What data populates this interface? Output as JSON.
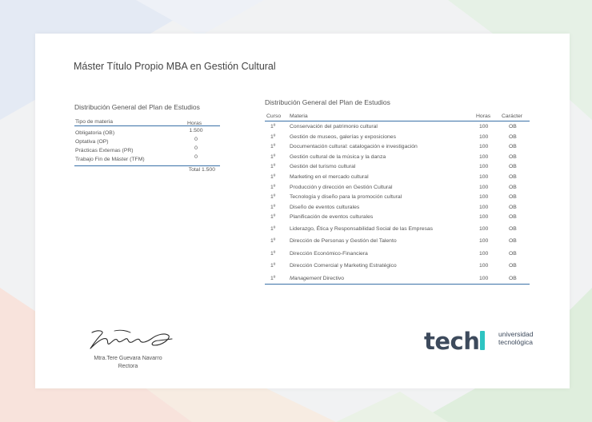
{
  "document": {
    "title": "Máster Título Propio MBA en Gestión Cultural"
  },
  "summary_table": {
    "heading": "Distribución General del Plan de Estudios",
    "col_type": "Tipo de materia",
    "col_hours": "Horas",
    "rows": [
      {
        "type": "Obligatoria (OB)",
        "hours": "1.500"
      },
      {
        "type": "Optativa (OP)",
        "hours": "0"
      },
      {
        "type": "Prácticas Externas (PR)",
        "hours": "0"
      },
      {
        "type": "Trabajo Fin de Máster (TFM)",
        "hours": "0"
      }
    ],
    "total": "Total 1.500"
  },
  "detail_table": {
    "heading": "Distribución General del Plan de Estudios",
    "col_course": "Curso",
    "col_subject": "Materia",
    "col_hours": "Horas",
    "col_type": "Carácter",
    "rows": [
      {
        "course": "1º",
        "subject": "Conservación del patrimonio cultural",
        "hours": "100",
        "type": "OB"
      },
      {
        "course": "1º",
        "subject": "Gestión de museos, galerías y exposiciones",
        "hours": "100",
        "type": "OB"
      },
      {
        "course": "1º",
        "subject": "Documentación cultural: catalogación e investigación",
        "hours": "100",
        "type": "OB"
      },
      {
        "course": "1º",
        "subject": "Gestión cultural de la música y la danza",
        "hours": "100",
        "type": "OB"
      },
      {
        "course": "1º",
        "subject": "Gestión del turismo cultural",
        "hours": "100",
        "type": "OB"
      },
      {
        "course": "1º",
        "subject": "Marketing en el mercado cultural",
        "hours": "100",
        "type": "OB"
      },
      {
        "course": "1º",
        "subject": "Producción y dirección en Gestión Cultural",
        "hours": "100",
        "type": "OB"
      },
      {
        "course": "1º",
        "subject": "Tecnología y diseño para la promoción cultural",
        "hours": "100",
        "type": "OB"
      },
      {
        "course": "1º",
        "subject": "Diseño de eventos culturales",
        "hours": "100",
        "type": "OB"
      },
      {
        "course": "1º",
        "subject": "Planificación de eventos culturales",
        "hours": "100",
        "type": "OB"
      },
      {
        "course": "1º",
        "subject": "Liderazgo, Ética y Responsabilidad Social de las Empresas",
        "hours": "100",
        "type": "OB"
      },
      {
        "course": "1º",
        "subject": "Dirección de Personas y Gestión del Talento",
        "hours": "100",
        "type": "OB"
      },
      {
        "course": "1º",
        "subject": "Dirección Económico-Financiera",
        "hours": "100",
        "type": "OB"
      },
      {
        "course": "1º",
        "subject": "Dirección Comercial y Marketing Estratégico",
        "hours": "100",
        "type": "OB"
      },
      {
        "course": "1º",
        "subject_italic": "Management",
        "subject": "Directivo",
        "hours": "100",
        "type": "OB"
      }
    ]
  },
  "signature": {
    "name": "Mtra.Tere Guevara Navarro",
    "role": "Rectora"
  },
  "logo": {
    "word": "tech",
    "line1": "universidad",
    "line2": "tecnológica",
    "accent_color": "#2ec4c2",
    "text_color": "#3d4a5c"
  },
  "colors": {
    "rule": "#3a71a8"
  }
}
